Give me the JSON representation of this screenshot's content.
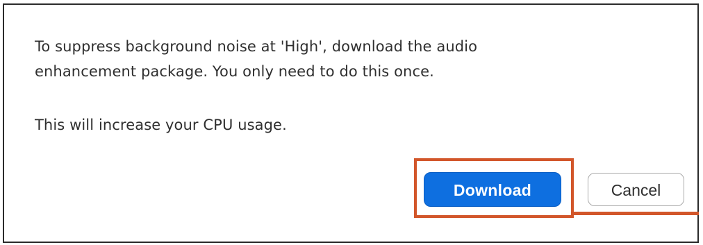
{
  "dialog": {
    "message_lines": [
      "To suppress background noise at 'High', download the audio",
      "enhancement package. You only need to do this once."
    ],
    "note": "This will increase your CPU usage.",
    "buttons": {
      "download_label": "Download",
      "cancel_label": "Cancel"
    }
  },
  "colors": {
    "primary_button": "#0e6fe0",
    "highlight_annotation": "#d2562a"
  }
}
